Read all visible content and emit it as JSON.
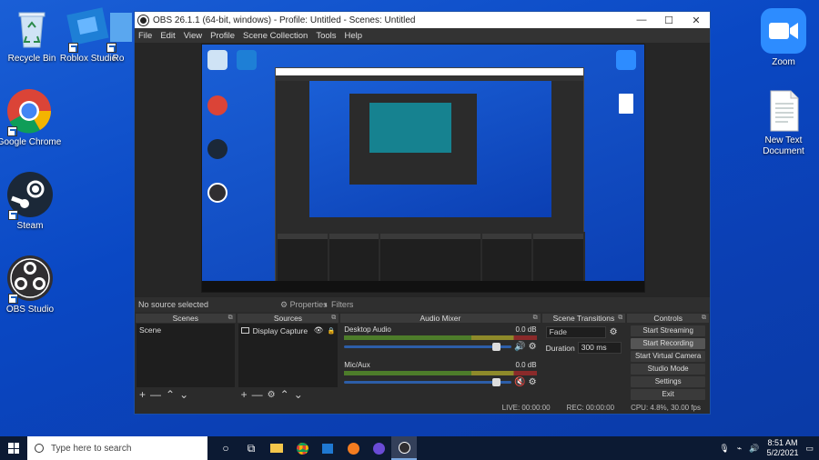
{
  "desktop": {
    "icons": [
      {
        "label": "Recycle Bin"
      },
      {
        "label": "Roblox Studio"
      },
      {
        "label": "Ro"
      },
      {
        "label": "Google Chrome"
      },
      {
        "label": "Steam"
      },
      {
        "label": "OBS Studio"
      },
      {
        "label": "Zoom"
      },
      {
        "label": "New Text Document"
      }
    ]
  },
  "window": {
    "title": "OBS 26.1.1 (64-bit, windows) - Profile: Untitled - Scenes: Untitled",
    "menu": [
      "File",
      "Edit",
      "View",
      "Profile",
      "Scene Collection",
      "Tools",
      "Help"
    ],
    "controls": {
      "minimize": "—",
      "maximize": "☐",
      "close": "✕"
    }
  },
  "source_bar": {
    "status": "No source selected",
    "properties": "Properties",
    "filters": "Filters"
  },
  "docks": {
    "scenes": {
      "title": "Scenes",
      "items": [
        "Scene"
      ]
    },
    "sources": {
      "title": "Sources",
      "items": [
        "Display Capture"
      ]
    },
    "mixer": {
      "title": "Audio Mixer",
      "channels": [
        {
          "name": "Desktop Audio",
          "level": "0.0 dB",
          "muted": false
        },
        {
          "name": "Mic/Aux",
          "level": "0.0 dB",
          "muted": true
        }
      ]
    },
    "transitions": {
      "title": "Scene Transitions",
      "type": "Fade",
      "duration_label": "Duration",
      "duration": "300 ms"
    },
    "controls": {
      "title": "Controls",
      "buttons": [
        "Start Streaming",
        "Start Recording",
        "Start Virtual Camera",
        "Studio Mode",
        "Settings",
        "Exit"
      ]
    }
  },
  "status": {
    "live": "LIVE: 00:00:00",
    "rec": "REC: 00:00:00",
    "cpu": "CPU: 4.8%, 30.00 fps"
  },
  "taskbar": {
    "search_placeholder": "Type here to search",
    "time": "8:51 AM",
    "date": "5/2/2021"
  },
  "colors": {
    "desktop": "#0b48c4",
    "obs_bg": "#2b2b2b",
    "taskbar": "#0c1a33"
  }
}
